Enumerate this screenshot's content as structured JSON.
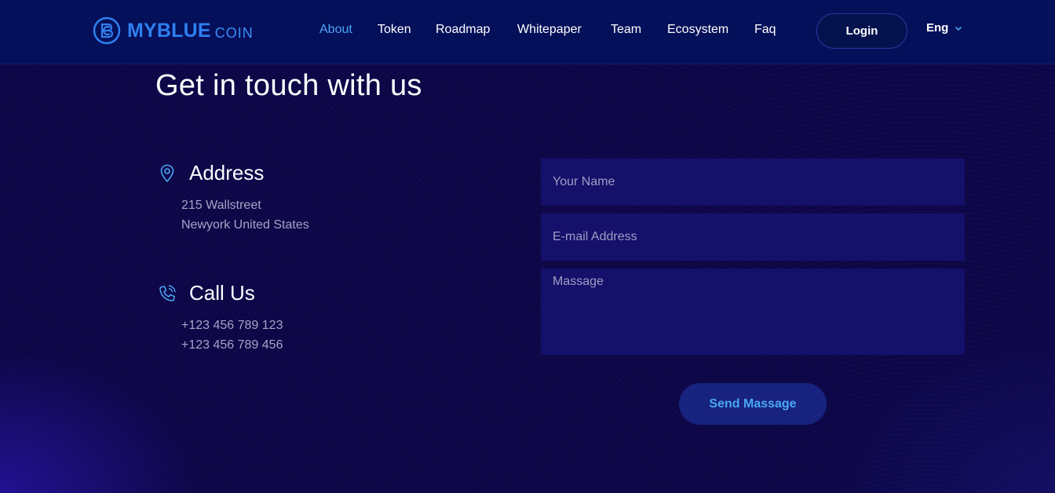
{
  "header": {
    "logo_main": "MYBLUE",
    "logo_sub": "COIN",
    "nav": [
      {
        "label": "About",
        "active": true
      },
      {
        "label": "Token"
      },
      {
        "label": "Roadmap"
      },
      {
        "label": "Whitepaper"
      },
      {
        "label": "Team"
      },
      {
        "label": "Ecosystem"
      },
      {
        "label": "Faq"
      }
    ],
    "login_label": "Login",
    "language": "Eng"
  },
  "contact": {
    "title": "Get in touch with us",
    "address": {
      "heading": "Address",
      "icon": "location-pin-icon",
      "lines": [
        "215 Wallstreet",
        "Newyork United States"
      ]
    },
    "call": {
      "heading": "Call Us",
      "icon": "phone-icon",
      "lines": [
        "+123 456 789 123",
        "+123 456 789 456"
      ]
    }
  },
  "form": {
    "name_placeholder": "Your Name",
    "email_placeholder": "E-mail Address",
    "message_placeholder": "Massage",
    "submit_label": "Send Massage"
  },
  "colors": {
    "background": "#0d0748",
    "header": "#05105a",
    "accent": "#4aa6f5",
    "field": "#15106a",
    "muted_text": "#a7a3c6"
  }
}
